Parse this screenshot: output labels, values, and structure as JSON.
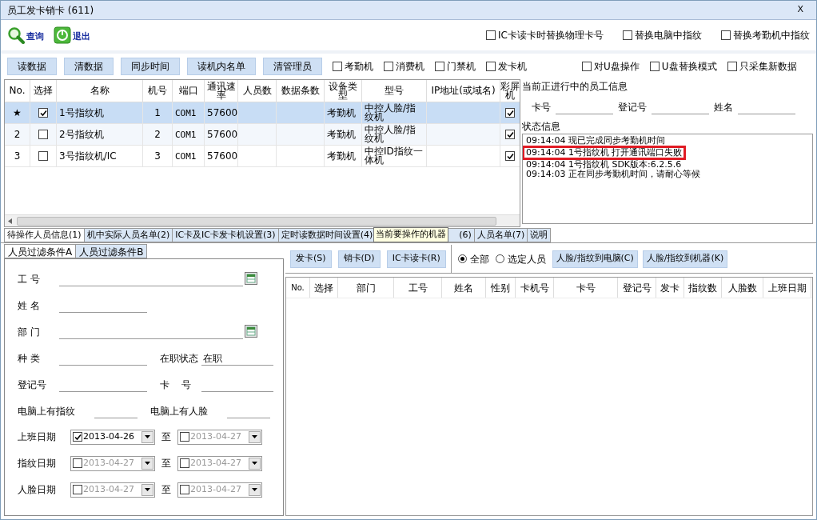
{
  "window": {
    "title": "员工发卡销卡 (611)",
    "close": "X"
  },
  "tools": [
    {
      "kind": "search",
      "label": "查询"
    },
    {
      "kind": "exit",
      "label": "退出"
    }
  ],
  "options": [
    {
      "label": "IC卡读卡时替换物理卡号",
      "checked": false
    },
    {
      "label": "替换电脑中指纹",
      "checked": false
    },
    {
      "label": "替换考勤机中指纹",
      "checked": false
    }
  ],
  "device_buttons": [
    "读数据",
    "清数据",
    "同步时间",
    "读机内名单",
    "清管理员"
  ],
  "device_filters": [
    {
      "label": "考勤机",
      "checked": false
    },
    {
      "label": "消费机",
      "checked": false
    },
    {
      "label": "门禁机",
      "checked": false
    },
    {
      "label": "发卡机",
      "checked": false
    },
    {
      "label": "对U盘操作",
      "checked": false
    },
    {
      "label": "U盘替换模式",
      "checked": false
    },
    {
      "label": "只采集新数据",
      "checked": false
    }
  ],
  "devices": {
    "columns": [
      "No.",
      "选择",
      "名称",
      "机号",
      "端口",
      "通讯速率",
      "人员数",
      "数据条数",
      "设备类型",
      "型号",
      "IP地址(或域名)",
      "彩屏机"
    ],
    "rows": [
      {
        "no": "★",
        "selected": true,
        "checked": true,
        "name": "1号指纹机",
        "number": "1",
        "port": "COM1",
        "baud": "57600",
        "type": "考勤机",
        "model": "中控人脸/指纹机",
        "color_screen": true
      },
      {
        "no": "2",
        "selected": false,
        "checked": false,
        "name": "2号指纹机",
        "number": "2",
        "port": "COM1",
        "baud": "57600",
        "type": "考勤机",
        "model": "中控人脸/指纹机",
        "color_screen": true
      },
      {
        "no": "3",
        "selected": false,
        "checked": false,
        "name": "3号指纹机/IC",
        "number": "3",
        "port": "COM1",
        "baud": "57600",
        "type": "考勤机",
        "model": "中控ID指纹一体机",
        "color_screen": true
      }
    ]
  },
  "employee_info": {
    "title": "当前正进行中的员工信息",
    "fields": [
      "卡号",
      "登记号",
      "姓名"
    ]
  },
  "status": {
    "title": "状态信息",
    "lines": [
      {
        "text": "09:14:04 现已完成同步考勤机时间",
        "highlighted": false
      },
      {
        "text": "09:14:04 1号指纹机 打开通讯端口失败",
        "highlighted": true
      },
      {
        "text": "09:14:04 1号指纹机 SDK版本:6.2.5.6",
        "highlighted": false
      },
      {
        "text": "09:14:03 正在同步考勤机时间，请耐心等候",
        "highlighted": false
      }
    ]
  },
  "tabs": [
    {
      "label": "待操作人员信息(1)",
      "selected": true
    },
    {
      "label": "机中实际人员名单(2)",
      "selected": false
    },
    {
      "label": "IC卡及IC卡发卡机设置(3)",
      "selected": false
    },
    {
      "label": "定时读数据时间设置(4)",
      "selected": false
    },
    {
      "label": "(6)",
      "selected": false
    },
    {
      "label": "人员名单(7)",
      "selected": false
    },
    {
      "label": "说明",
      "selected": false
    }
  ],
  "tooltip": "当前要操作的机器",
  "filter_tabs": [
    {
      "label": "人员过滤条件A",
      "selected": true
    },
    {
      "label": "人员过滤条件B",
      "selected": false
    }
  ],
  "filter_form": [
    [
      {
        "label": "工 号",
        "kind": "lookup"
      }
    ],
    [
      {
        "label": "姓 名",
        "kind": "text"
      }
    ],
    [
      {
        "label": "部 门",
        "kind": "lookup"
      }
    ],
    [
      {
        "label": "种 类",
        "kind": "text"
      },
      {
        "label": "在职状态",
        "kind": "text",
        "value": "在职"
      }
    ],
    [
      {
        "label": "登记号",
        "kind": "text"
      },
      {
        "label": "卡    号",
        "kind": "text"
      }
    ],
    [
      {
        "label": "电脑上有指纹",
        "kind": "short"
      },
      {
        "label": "电脑上有人脸",
        "kind": "short"
      }
    ]
  ],
  "date_filters": [
    {
      "label": "上班日期",
      "from": {
        "checked": true,
        "value": "2013-04-26"
      },
      "sep": "至",
      "to": {
        "checked": false,
        "value": "2013-04-27"
      }
    },
    {
      "label": "指纹日期",
      "from": {
        "checked": false,
        "value": "2013-04-27"
      },
      "sep": "至",
      "to": {
        "checked": false,
        "value": "2013-04-27"
      }
    },
    {
      "label": "人脸日期",
      "from": {
        "checked": false,
        "value": "2013-04-27"
      },
      "sep": "至",
      "to": {
        "checked": false,
        "value": "2013-04-27"
      }
    }
  ],
  "card_buttons": [
    "发卡(S)",
    "销卡(D)",
    "IC卡读卡(R)"
  ],
  "scope": [
    {
      "label": "全部",
      "selected": true
    },
    {
      "label": "选定人员",
      "selected": false
    }
  ],
  "transfer_buttons": [
    "人脸/指纹到电脑(C)",
    "人脸/指纹到机器(K)"
  ],
  "people": {
    "columns": [
      "No.",
      "选择",
      "部门",
      "工号",
      "姓名",
      "性别",
      "卡机号",
      "卡号",
      "登记号",
      "发卡",
      "指纹数",
      "人脸数",
      "上班日期"
    ]
  }
}
